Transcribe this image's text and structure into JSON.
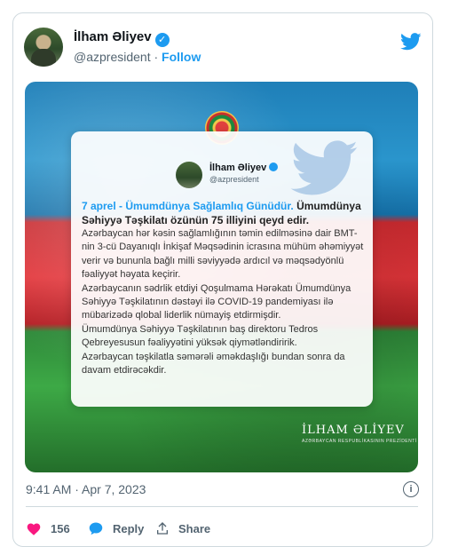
{
  "tweet": {
    "author_name": "İlham Əliyev",
    "handle": "@azpresident",
    "separator": "·",
    "follow_label": "Follow",
    "timestamp": "9:41 AM · Apr 7, 2023",
    "likes": "156",
    "reply_label": "Reply",
    "share_label": "Share"
  },
  "image": {
    "inner_author": "İlham Əliyev",
    "inner_handle": "@azpresident",
    "lead_highlight": "7 aprel - Ümumdünya Sağlamlıq Günüdür.",
    "lead_rest": "Ümumdünya Səhiyyə Təşkilatı özünün 75 illiyini qeyd edir.",
    "para1": "Azərbaycan hər kəsin sağlamlığının təmin edilməsinə dair BMT-nin 3-cü Dayanıqlı İnkişaf Məqsədinin icrasına mühüm əhəmiyyət verir və bununla bağlı milli səviyyədə ardıcıl və məqsədyönlü fəaliyyət həyata keçirir.",
    "para2": "Azərbaycanın sədrlik etdiyi Qoşulmama Hərəkatı Ümumdünya Səhiyyə Təşkilatının dəstəyi ilə COVID-19 pandemiyası ilə mübarizədə qlobal liderlik nümayiş etdirmişdir.",
    "para3": "Ümumdünya Səhiyyə Təşkilatının baş direktoru Tedros Qebreyesusun fəaliyyətini yüksək qiymətləndiririk.",
    "para4": "Azərbaycan təşkilatla səmərəli əməkdaşlığı bundan sonra da davam etdirəcəkdir.",
    "signature": "İLHAM ƏLİYEV",
    "signature_sub": "AZƏRBAYCAN RESPUBLİKASININ PREZİDENTİ"
  },
  "colors": {
    "accent": "#1d9bf0",
    "like": "#f91880",
    "flag_blue": "#2a95cc",
    "flag_red": "#e2353a",
    "flag_green": "#3da946"
  },
  "icons": [
    "twitter-bird-icon",
    "verified-badge-icon",
    "info-icon",
    "heart-icon",
    "reply-bubble-icon",
    "share-icon",
    "emblem-icon"
  ]
}
